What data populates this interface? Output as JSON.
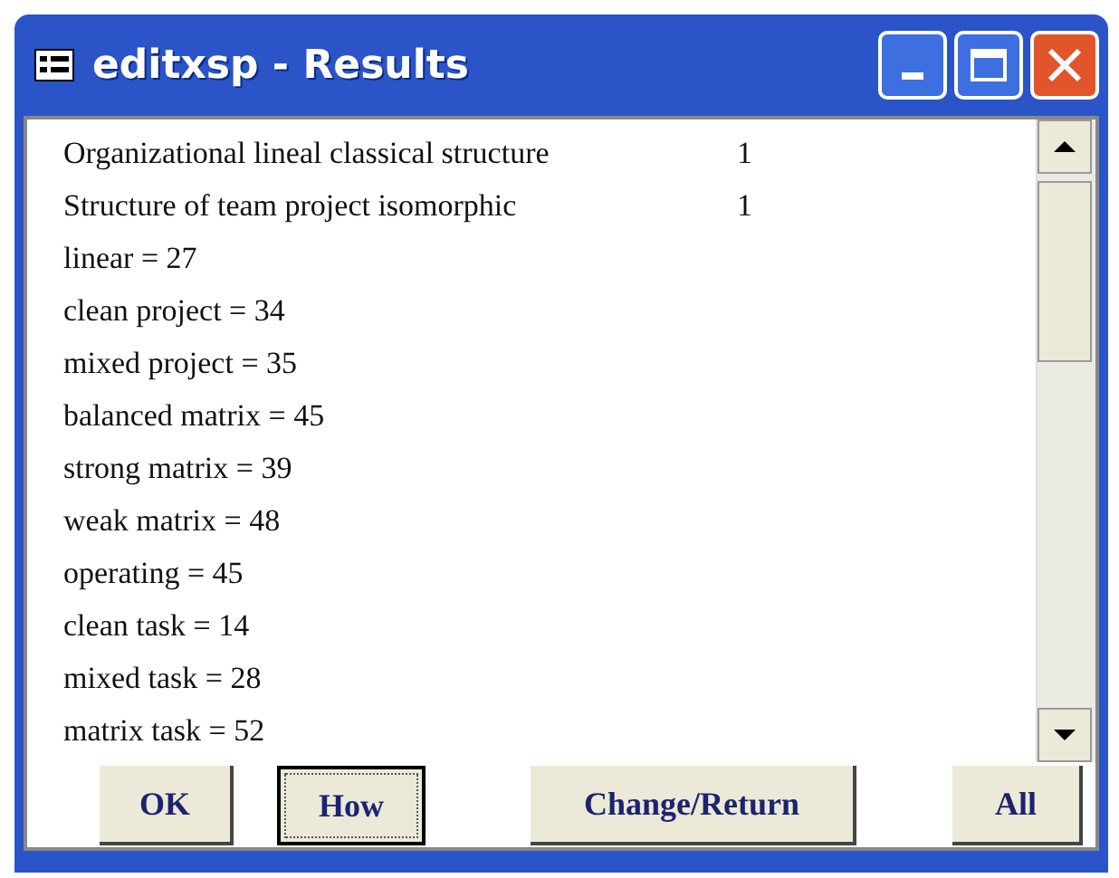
{
  "window": {
    "title": "editxsp - Results"
  },
  "results": [
    {
      "text": "Organizational lineal classical structure",
      "value": "1"
    },
    {
      "text": "Structure of team project isomorphic",
      "value": "1"
    },
    {
      "text": "linear = 27"
    },
    {
      "text": "clean project = 34"
    },
    {
      "text": "mixed project = 35"
    },
    {
      "text": "balanced matrix = 45"
    },
    {
      "text": "strong matrix = 39"
    },
    {
      "text": "weak matrix = 48"
    },
    {
      "text": "operating = 45"
    },
    {
      "text": "clean task = 14"
    },
    {
      "text": "mixed task = 28"
    },
    {
      "text": "matrix task = 52"
    }
  ],
  "buttons": [
    {
      "label": "OK",
      "focused": false
    },
    {
      "label": "How",
      "focused": true
    },
    {
      "label": "Change/Return",
      "focused": false
    },
    {
      "label": "All",
      "focused": false
    }
  ]
}
